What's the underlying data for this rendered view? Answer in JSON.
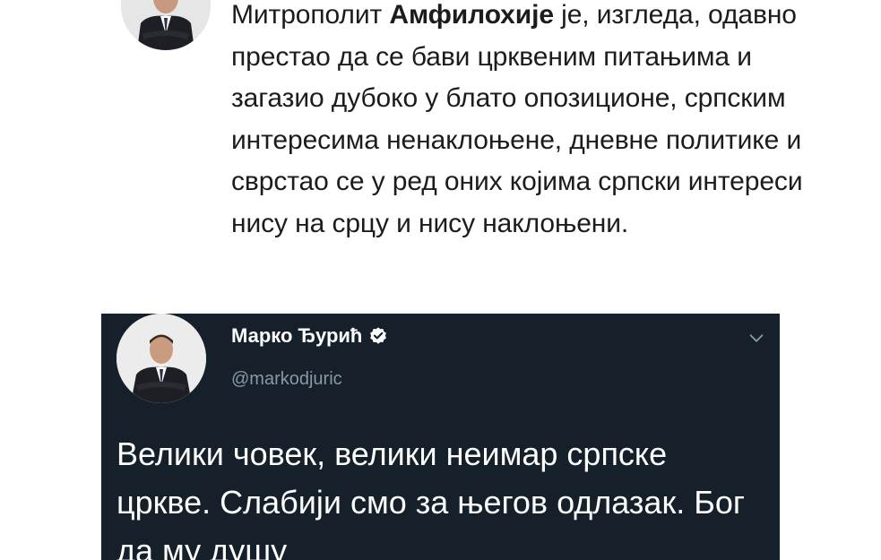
{
  "top_tweet": {
    "avatar_icon": "profile-photo",
    "text_prefix": "Митрополит ",
    "text_bold": "Амфилохије",
    "text_rest": " је, изгледа, одавно престао да се бави црквеним питањима и загазио дубоко у блато опозиционе, српским интересима ненаклоњене, дневне политике и сврстао се у ред оних којима српски интереси нису на срцу и нису наклоњени."
  },
  "dark_tweet": {
    "display_name": "Марко Ђурић",
    "handle": "@markodjuric",
    "verified_icon": "verified-badge-icon",
    "menu_icon": "chevron-down-icon",
    "text": "Велики човек, велики неимар српске цркве. Слабији смо за његов одлазак. Бог да му душу"
  },
  "colors": {
    "dark_background": "#15202b",
    "handle_gray": "#8899a6",
    "text_dark": "#1c1c1c"
  }
}
